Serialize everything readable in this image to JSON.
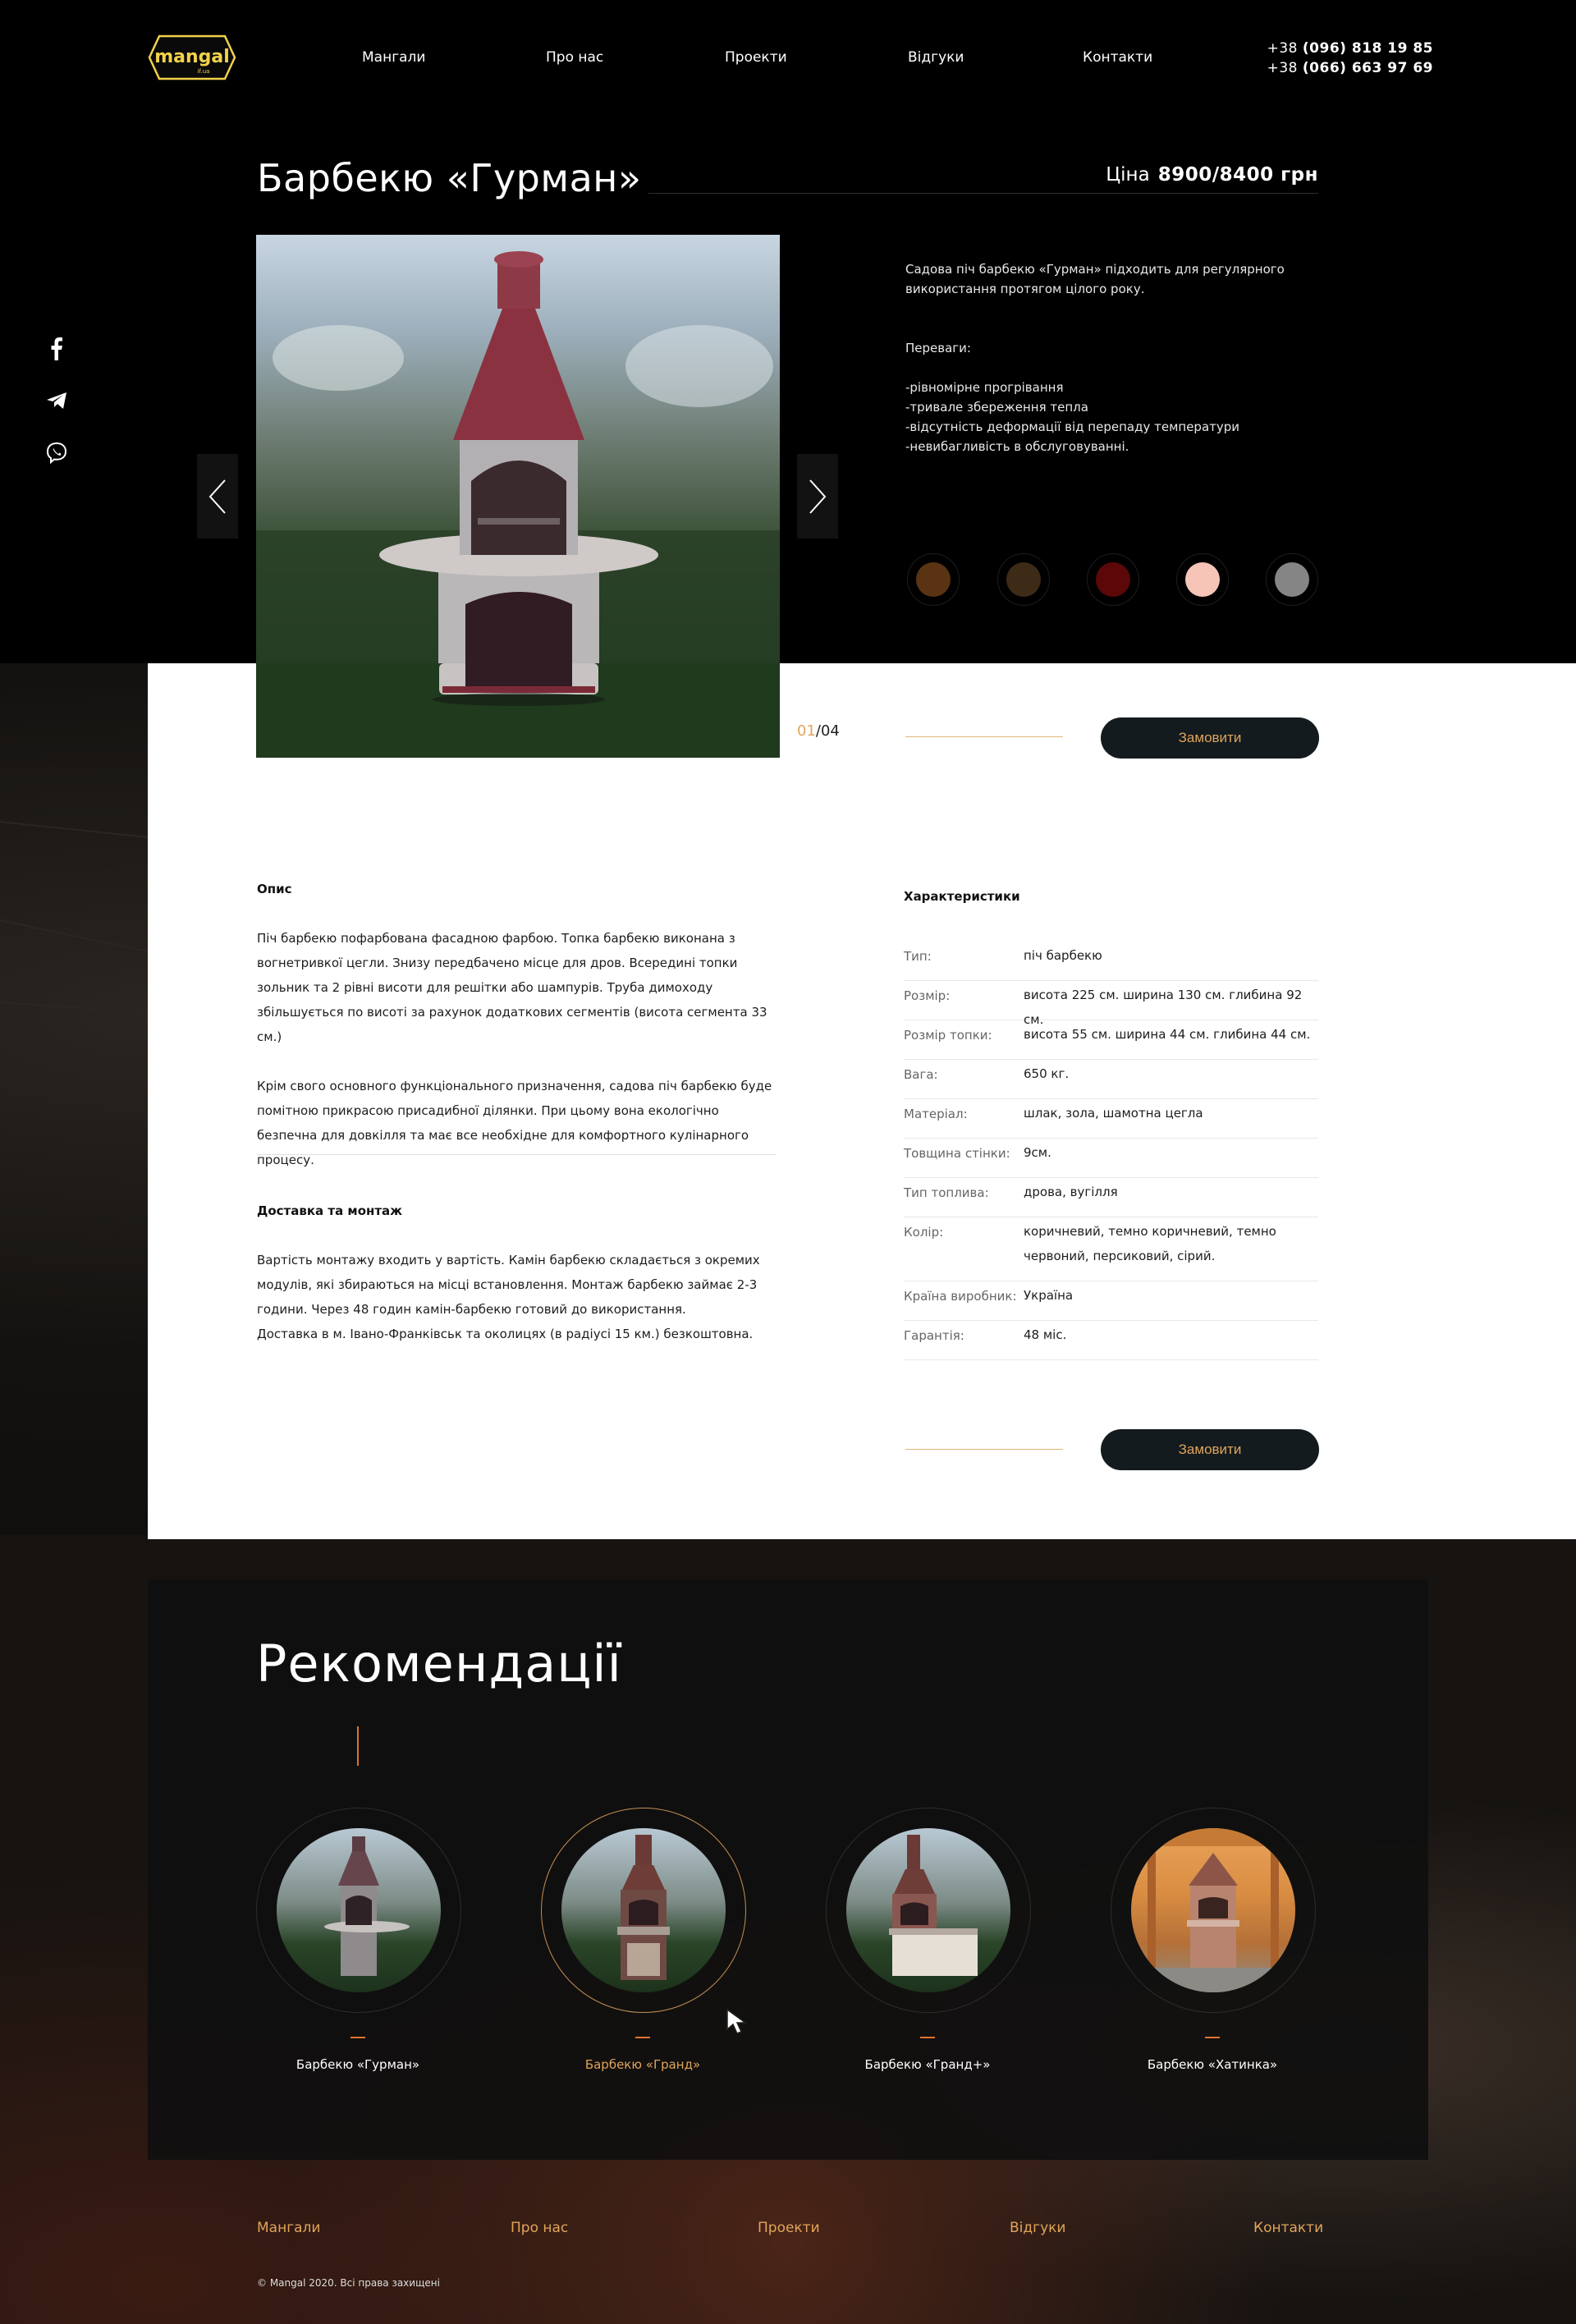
{
  "header": {
    "logo_text": "mangal",
    "logo_sub": "if.ua",
    "nav": [
      "Мангали",
      "Про нас",
      "Проекти",
      "Відгуки",
      "Контакти"
    ],
    "phones": [
      {
        "prefix": "+38 ",
        "number": "(096) 818 19 85"
      },
      {
        "prefix": "+38 ",
        "number": "(066) 663 97 69"
      }
    ]
  },
  "social": [
    "facebook-icon",
    "telegram-icon",
    "viber-icon"
  ],
  "product": {
    "title": "Барбекю «Гурман»",
    "price_label": "Ціна",
    "price_value": "8900/8400 грн",
    "intro": "Садова піч барбекю «Гурман» підходить для регулярного використання протягом цілого року.",
    "advantages_title": "Переваги:",
    "advantages": [
      "-рівномірне прогрівання",
      "-тривале збереження тепла",
      "-відсутність деформації від перепаду температури",
      "-невибагливість в обслуговуванні."
    ],
    "swatches": [
      "#5a3412",
      "#3d2a17",
      "#5c0808",
      "#f7c4b8",
      "#858585"
    ],
    "counter_current": "01",
    "counter_total": "/04",
    "order_label": "Замовити"
  },
  "details": {
    "description_title": "Опис",
    "description_p1": "Піч барбекю пофарбована фасадною фарбою. Топка барбекю виконана з вогнетривкої цегли. Знизу передбачено місце для дров. Всередині топки зольник та 2 рівні висоти для решітки або шампурів. Труба димоходу збільшується по висоті за рахунок додаткових сегментів (висота сегмента 33 см.)",
    "description_p2": "Крім свого основного функціонального призначення, садова піч барбекю буде помітною прикрасою присадибної ділянки. При цьому вона екологічно безпечна для довкілля та має все необхідне для комфортного кулінарного процесу.",
    "delivery_title": "Доставка та монтаж",
    "delivery_p1": "Вартість монтажу входить у вартість. Камін барбекю складається з окремих модулів, які збираються на місці встановлення. Монтаж барбекю займає 2-3 години. Через 48 годин камін-барбекю готовий до використання.",
    "delivery_p2": "Доставка в м. Івано-Франківськ та околицях (в радіусі 15 км.) безкоштовна.",
    "specs_title": "Характеристики",
    "specs": [
      {
        "key": "Тип:",
        "value": "піч барбекю"
      },
      {
        "key": "Розмір:",
        "value": "висота 225 см. ширина 130 см. глибина 92 см."
      },
      {
        "key": "Розмір топки:",
        "value": "висота 55 см. ширина 44 см. глибина 44 см."
      },
      {
        "key": "Вага:",
        "value": "650 кг."
      },
      {
        "key": "Матеріал:",
        "value": "шлак, зола, шамотна цегла"
      },
      {
        "key": "Товщина стінки:",
        "value": "9см."
      },
      {
        "key": "Тип топлива:",
        "value": "дрова, вугілля"
      },
      {
        "key": "Колір:",
        "value": "коричневий, темно коричневий, темно червоний, персиковий, сірий."
      },
      {
        "key": "Країна виробник:",
        "value": "Україна"
      },
      {
        "key": "Гарантія:",
        "value": "48 міс."
      }
    ],
    "order_label": "Замовити"
  },
  "recommendations": {
    "title": "Рекомендації",
    "items": [
      {
        "label": "Барбекю «Гурман»",
        "active": false
      },
      {
        "label": "Барбекю «Гранд»",
        "active": true
      },
      {
        "label": "Барбекю «Гранд+»",
        "active": false
      },
      {
        "label": "Барбекю «Хатинка»",
        "active": false
      }
    ]
  },
  "footer": {
    "links": [
      "Мангали",
      "Про нас",
      "Проекти",
      "Відгуки",
      "Контакти"
    ],
    "copyright": "© Mangal 2020. Всі права захищені"
  }
}
